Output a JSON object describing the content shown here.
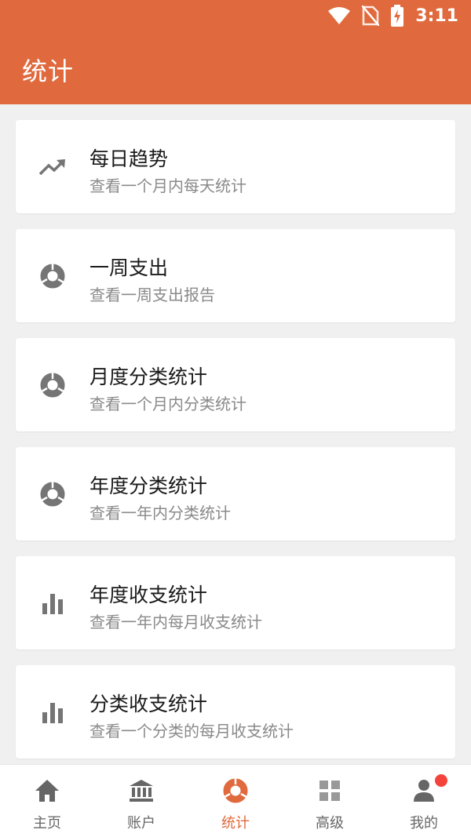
{
  "status_bar": {
    "time": "3:11"
  },
  "header": {
    "title": "统计"
  },
  "items": [
    {
      "title": "每日趋势",
      "desc": "查看一个月内每天统计",
      "icon": "trending-up-icon"
    },
    {
      "title": "一周支出",
      "desc": "查看一周支出报告",
      "icon": "donut-chart-icon"
    },
    {
      "title": "月度分类统计",
      "desc": "查看一个月内分类统计",
      "icon": "donut-chart-icon"
    },
    {
      "title": "年度分类统计",
      "desc": "查看一年内分类统计",
      "icon": "donut-chart-icon"
    },
    {
      "title": "年度收支统计",
      "desc": "查看一年内每月收支统计",
      "icon": "bar-chart-icon"
    },
    {
      "title": "分类收支统计",
      "desc": "查看一个分类的每月收支统计",
      "icon": "bar-chart-icon"
    }
  ],
  "bottom_nav": [
    {
      "label": "主页",
      "icon": "home-icon"
    },
    {
      "label": "账户",
      "icon": "bank-icon"
    },
    {
      "label": "统计",
      "icon": "donut-chart-icon",
      "active": true
    },
    {
      "label": "高级",
      "icon": "grid-icon"
    },
    {
      "label": "我的",
      "icon": "person-icon",
      "badge": true
    }
  ],
  "colors": {
    "accent": "#e06a3e",
    "background": "#f0f0f0",
    "icon_gray": "#757575",
    "badge": "#f4433a"
  }
}
